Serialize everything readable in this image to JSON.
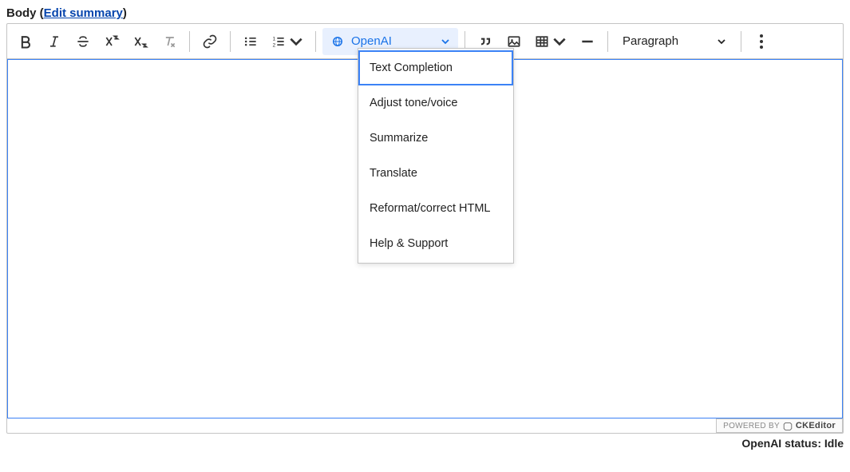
{
  "field": {
    "label": "Body",
    "edit_summary": "Edit summary"
  },
  "toolbar": {
    "openai_label": "OpenAI",
    "paragraph_label": "Paragraph"
  },
  "openai_menu": {
    "items": [
      "Text Completion",
      "Adjust tone/voice",
      "Summarize",
      "Translate",
      "Reformat/correct HTML",
      "Help & Support"
    ]
  },
  "footer": {
    "powered_by": "POWERED BY",
    "brand": "CKEditor"
  },
  "status": {
    "text": "OpenAI status: Idle"
  }
}
